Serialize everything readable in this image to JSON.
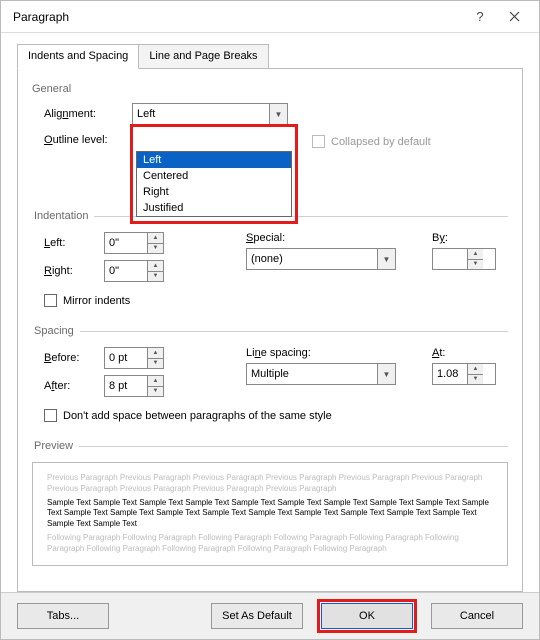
{
  "title": "Paragraph",
  "tabs": {
    "active": "Indents and Spacing",
    "other": "Line and Page Breaks"
  },
  "general": {
    "heading": "General",
    "alignment_label": "Alignment:",
    "alignment_value": "Left",
    "alignment_options": [
      "Left",
      "Centered",
      "Right",
      "Justified"
    ],
    "outline_label": "Outline level:",
    "collapsed_label": "Collapsed by default"
  },
  "indentation": {
    "heading": "Indentation",
    "left_label": "Left:",
    "left_value": "0\"",
    "right_label": "Right:",
    "right_value": "0\"",
    "special_label": "Special:",
    "special_value": "(none)",
    "by_label": "By:",
    "mirror_label": "Mirror indents"
  },
  "spacing": {
    "heading": "Spacing",
    "before_label": "Before:",
    "before_value": "0 pt",
    "after_label": "After:",
    "after_value": "8 pt",
    "line_label": "Line spacing:",
    "line_value": "Multiple",
    "at_label": "At:",
    "at_value": "1.08",
    "dont_add_label": "Don't add space between paragraphs of the same style"
  },
  "preview": {
    "heading": "Preview",
    "grey_before": "Previous Paragraph Previous Paragraph Previous Paragraph Previous Paragraph Previous Paragraph Previous Paragraph Previous Paragraph Previous Paragraph Previous Paragraph Previous Paragraph",
    "sample": "Sample Text Sample Text Sample Text Sample Text Sample Text Sample Text Sample Text Sample Text Sample Text Sample Text Sample Text Sample Text Sample Text Sample Text Sample Text Sample Text Sample Text Sample Text Sample Text Sample Text Sample Text",
    "grey_after": "Following Paragraph Following Paragraph Following Paragraph Following Paragraph Following Paragraph Following Paragraph Following Paragraph Following Paragraph Following Paragraph Following Paragraph"
  },
  "buttons": {
    "tabs": "Tabs...",
    "default": "Set As Default",
    "ok": "OK",
    "cancel": "Cancel"
  }
}
